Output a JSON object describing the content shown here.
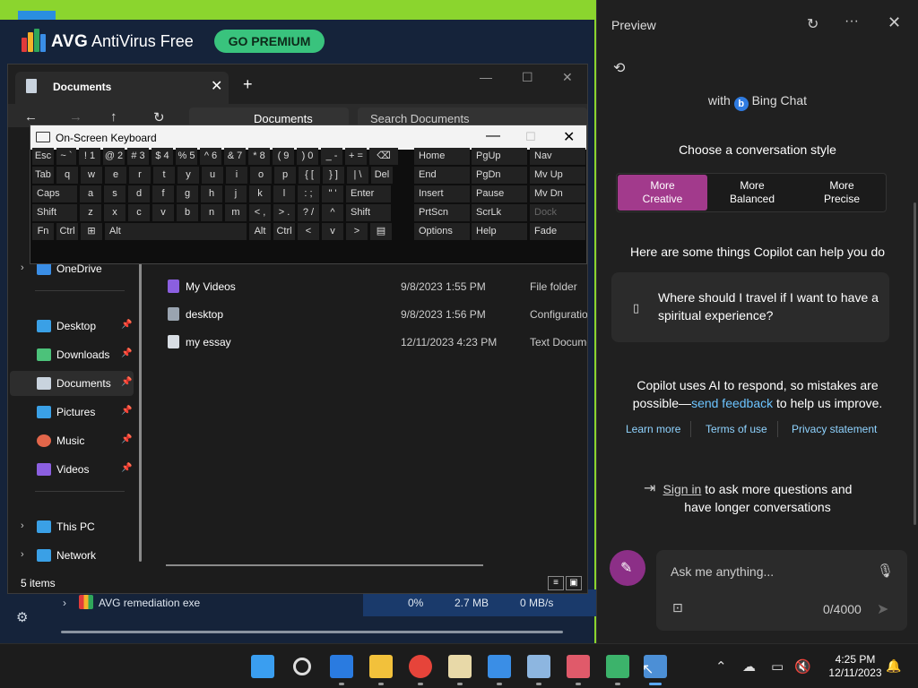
{
  "avg": {
    "brand": "AVG",
    "product": "AntiVirus Free",
    "premium_label": "GO PREMIUM",
    "process_row": {
      "name": "AVG remediation exe",
      "cpu": "0%",
      "memory": "2.7 MB",
      "disk": "0 MB/s"
    }
  },
  "explorer": {
    "tab_label": "Documents",
    "address": "Documents",
    "search_placeholder": "Search Documents",
    "sidebar": [
      {
        "label": "OneDrive",
        "icon": "cloud-icon",
        "color": "#3a8ee6",
        "pinned": false,
        "expandable": true
      },
      {
        "label": "Desktop",
        "icon": "desktop-icon",
        "color": "#3aa0e6",
        "pinned": true,
        "expandable": false
      },
      {
        "label": "Downloads",
        "icon": "download-icon",
        "color": "#4cc27a",
        "pinned": true,
        "expandable": false
      },
      {
        "label": "Documents",
        "icon": "document-icon",
        "color": "#c9d3de",
        "pinned": true,
        "expandable": false
      },
      {
        "label": "Pictures",
        "icon": "picture-icon",
        "color": "#3aa0e6",
        "pinned": true,
        "expandable": false
      },
      {
        "label": "Music",
        "icon": "music-icon",
        "color": "#e2664a",
        "pinned": true,
        "expandable": false
      },
      {
        "label": "Videos",
        "icon": "video-icon",
        "color": "#8b5fe0",
        "pinned": true,
        "expandable": false
      },
      {
        "label": "This PC",
        "icon": "computer-icon",
        "color": "#3aa0e6",
        "pinned": false,
        "expandable": true
      },
      {
        "label": "Network",
        "icon": "network-icon",
        "color": "#3aa0e6",
        "pinned": false,
        "expandable": true
      }
    ],
    "files": [
      {
        "name": "My Videos",
        "date": "9/8/2023 1:55 PM",
        "type": "File folder",
        "icon": "video-folder-icon",
        "color": "#8b5fe0"
      },
      {
        "name": "desktop",
        "date": "9/8/2023 1:56 PM",
        "type": "Configuration",
        "icon": "config-file-icon",
        "color": "#9aa4b0"
      },
      {
        "name": "my essay",
        "date": "12/11/2023 4:23 PM",
        "type": "Text Document",
        "icon": "text-file-icon",
        "color": "#d8dde3"
      }
    ],
    "status": "5 items"
  },
  "osk": {
    "title": "On-Screen Keyboard",
    "rows": [
      [
        "Esc",
        "~ `",
        "! 1",
        "@ 2",
        "# 3",
        "$ 4",
        "% 5",
        "^ 6",
        "& 7",
        "* 8",
        "( 9",
        ") 0",
        "_ -",
        "+ =",
        "⌫"
      ],
      [
        "Tab",
        "q",
        "w",
        "e",
        "r",
        "t",
        "y",
        "u",
        "i",
        "o",
        "p",
        "{ [",
        "} ]",
        "| \\",
        "Del"
      ],
      [
        "Caps",
        "a",
        "s",
        "d",
        "f",
        "g",
        "h",
        "j",
        "k",
        "l",
        ": ;",
        "\" '",
        "Enter"
      ],
      [
        "Shift",
        "z",
        "x",
        "c",
        "v",
        "b",
        "n",
        "m",
        "< ,",
        "> .",
        "? /",
        "^",
        "Shift"
      ],
      [
        "Fn",
        "Ctrl",
        "⊞",
        "Alt",
        "Alt",
        "Ctrl",
        "<",
        "v",
        ">",
        "▤"
      ]
    ],
    "nav_keys": [
      [
        "Home",
        "PgUp",
        "Nav"
      ],
      [
        "End",
        "PgDn",
        "Mv Up"
      ],
      [
        "Insert",
        "Pause",
        "Mv Dn"
      ],
      [
        "PrtScn",
        "ScrLk",
        "Dock"
      ],
      [
        "Options",
        "Help",
        "Fade"
      ]
    ]
  },
  "copilot": {
    "title": "Preview",
    "with_prefix": "with",
    "bing_chat": "Bing Chat",
    "choose_style": "Choose a conversation style",
    "styles": [
      {
        "line1": "More",
        "line2": "Creative",
        "active": true
      },
      {
        "line1": "More",
        "line2": "Balanced",
        "active": false
      },
      {
        "line1": "More",
        "line2": "Precise",
        "active": false
      }
    ],
    "help_heading": "Here are some things Copilot can help you do",
    "suggestion": "Where should I travel if I want to have a spiritual experience?",
    "disclaimer_1": "Copilot uses AI to respond, so mistakes are",
    "disclaimer_2a": "possible—",
    "disclaimer_link": "send feedback",
    "disclaimer_2b": " to help us improve.",
    "links": [
      "Learn more",
      "Terms of use",
      "Privacy statement"
    ],
    "signin_link": "Sign in",
    "signin_rest": " to ask more questions and",
    "signin_line2": "have longer conversations",
    "input_placeholder": "Ask me anything...",
    "char_count": "0/4000",
    "accent": "#a23a8c"
  },
  "taskbar": {
    "apps": [
      {
        "name": "start-icon",
        "color": "#3a9ef0"
      },
      {
        "name": "search-icon",
        "color": "#1c1c1c"
      },
      {
        "name": "edge-beta-icon",
        "color": "#2a7be0"
      },
      {
        "name": "file-explorer-icon",
        "color": "#f2c13b"
      },
      {
        "name": "chrome-icon",
        "color": "#e6443a"
      },
      {
        "name": "notepad-icon",
        "color": "#e8d9a8"
      },
      {
        "name": "teams-icon",
        "color": "#3a8ee6"
      },
      {
        "name": "performance-monitor-icon",
        "color": "#8db6e0"
      },
      {
        "name": "snipping-tool-icon",
        "color": "#e05a6a"
      },
      {
        "name": "avg-icon",
        "color": "#3cb36b"
      },
      {
        "name": "on-screen-keyboard-icon",
        "color": "#4c8fd6"
      }
    ],
    "time": "4:25 PM",
    "date": "12/11/2023"
  }
}
